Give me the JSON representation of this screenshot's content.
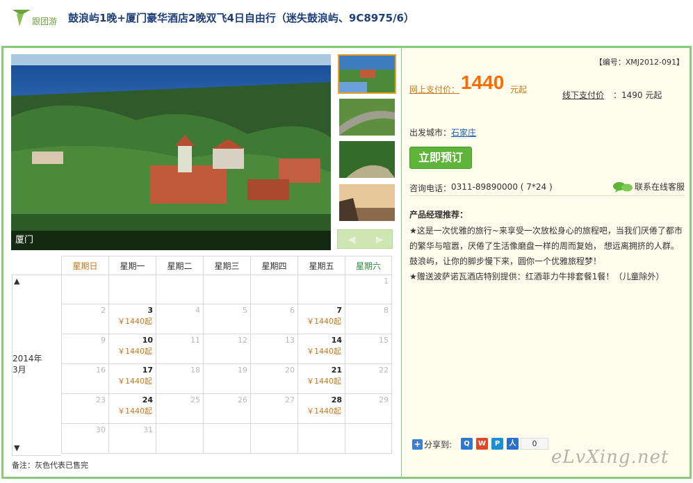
{
  "header": {
    "logo_text": "跟团游",
    "title": "鼓浪屿1晚+厦门豪华酒店2晚双飞4日自由行（迷失鼓浪屿、9C8975/6）"
  },
  "gallery": {
    "caption": "厦门",
    "prev_icon": "◀",
    "next_icon": "▶"
  },
  "calendar": {
    "up_icon": "▲",
    "down_icon": "▼",
    "year": "2014年",
    "month": "3月",
    "weekdays": [
      "星期日",
      "星期一",
      "星期二",
      "星期三",
      "星期四",
      "星期五",
      "星期六"
    ],
    "weeks": [
      [
        {
          "d": ""
        },
        {
          "d": ""
        },
        {
          "d": ""
        },
        {
          "d": ""
        },
        {
          "d": ""
        },
        {
          "d": ""
        },
        {
          "d": "1"
        }
      ],
      [
        {
          "d": "2"
        },
        {
          "d": "3",
          "p": "￥1440起"
        },
        {
          "d": "4"
        },
        {
          "d": "5"
        },
        {
          "d": "6"
        },
        {
          "d": "7",
          "p": "￥1440起"
        },
        {
          "d": "8"
        }
      ],
      [
        {
          "d": "9"
        },
        {
          "d": "10",
          "p": "￥1440起"
        },
        {
          "d": "11"
        },
        {
          "d": "12"
        },
        {
          "d": "13"
        },
        {
          "d": "14",
          "p": "￥1440起"
        },
        {
          "d": "15"
        }
      ],
      [
        {
          "d": "16"
        },
        {
          "d": "17",
          "p": "￥1440起"
        },
        {
          "d": "18"
        },
        {
          "d": "19"
        },
        {
          "d": "20"
        },
        {
          "d": "21",
          "p": "￥1440起"
        },
        {
          "d": "22"
        }
      ],
      [
        {
          "d": "23"
        },
        {
          "d": "24",
          "p": "￥1440起"
        },
        {
          "d": "25"
        },
        {
          "d": "26"
        },
        {
          "d": "27"
        },
        {
          "d": "28",
          "p": "￥1440起"
        },
        {
          "d": "29"
        }
      ],
      [
        {
          "d": "30"
        },
        {
          "d": "31"
        },
        {
          "d": ""
        },
        {
          "d": ""
        },
        {
          "d": ""
        },
        {
          "d": ""
        },
        {
          "d": ""
        }
      ]
    ],
    "note": "备注：灰色代表已售完"
  },
  "info": {
    "code": "【编号：XMJ2012-091】",
    "online_label": "网上支付价：",
    "online_price": "1440",
    "online_unit": "元起",
    "offline_label": "线下支付价",
    "offline_price": "：1490 元起",
    "depart_label": "出发城市：",
    "depart_city": "石家庄",
    "book_button": "立即预订",
    "phone_label": "咨询电话：",
    "phone": "0311-89890000 ( 7*24 )",
    "service_label": "联系在线客服",
    "rec_title": "产品经理推荐：",
    "rec_lines": [
      "★这是一次优雅的旅行~来享受一次放松身心的旅程吧，当我们厌倦了都市的繁华与喧嚣，厌倦了生活像磨盘一样的周而复始， 想远离拥挤的人群。鼓浪屿，让你的脚步慢下来，圆你一个优雅旅程梦！",
      "★赠送波萨诺瓦酒店特别提供：红酒菲力牛排套餐1餐！（儿童除外）"
    ],
    "share_label": "分享到:",
    "share_count": "0",
    "watermark": "eLvXing.net"
  }
}
